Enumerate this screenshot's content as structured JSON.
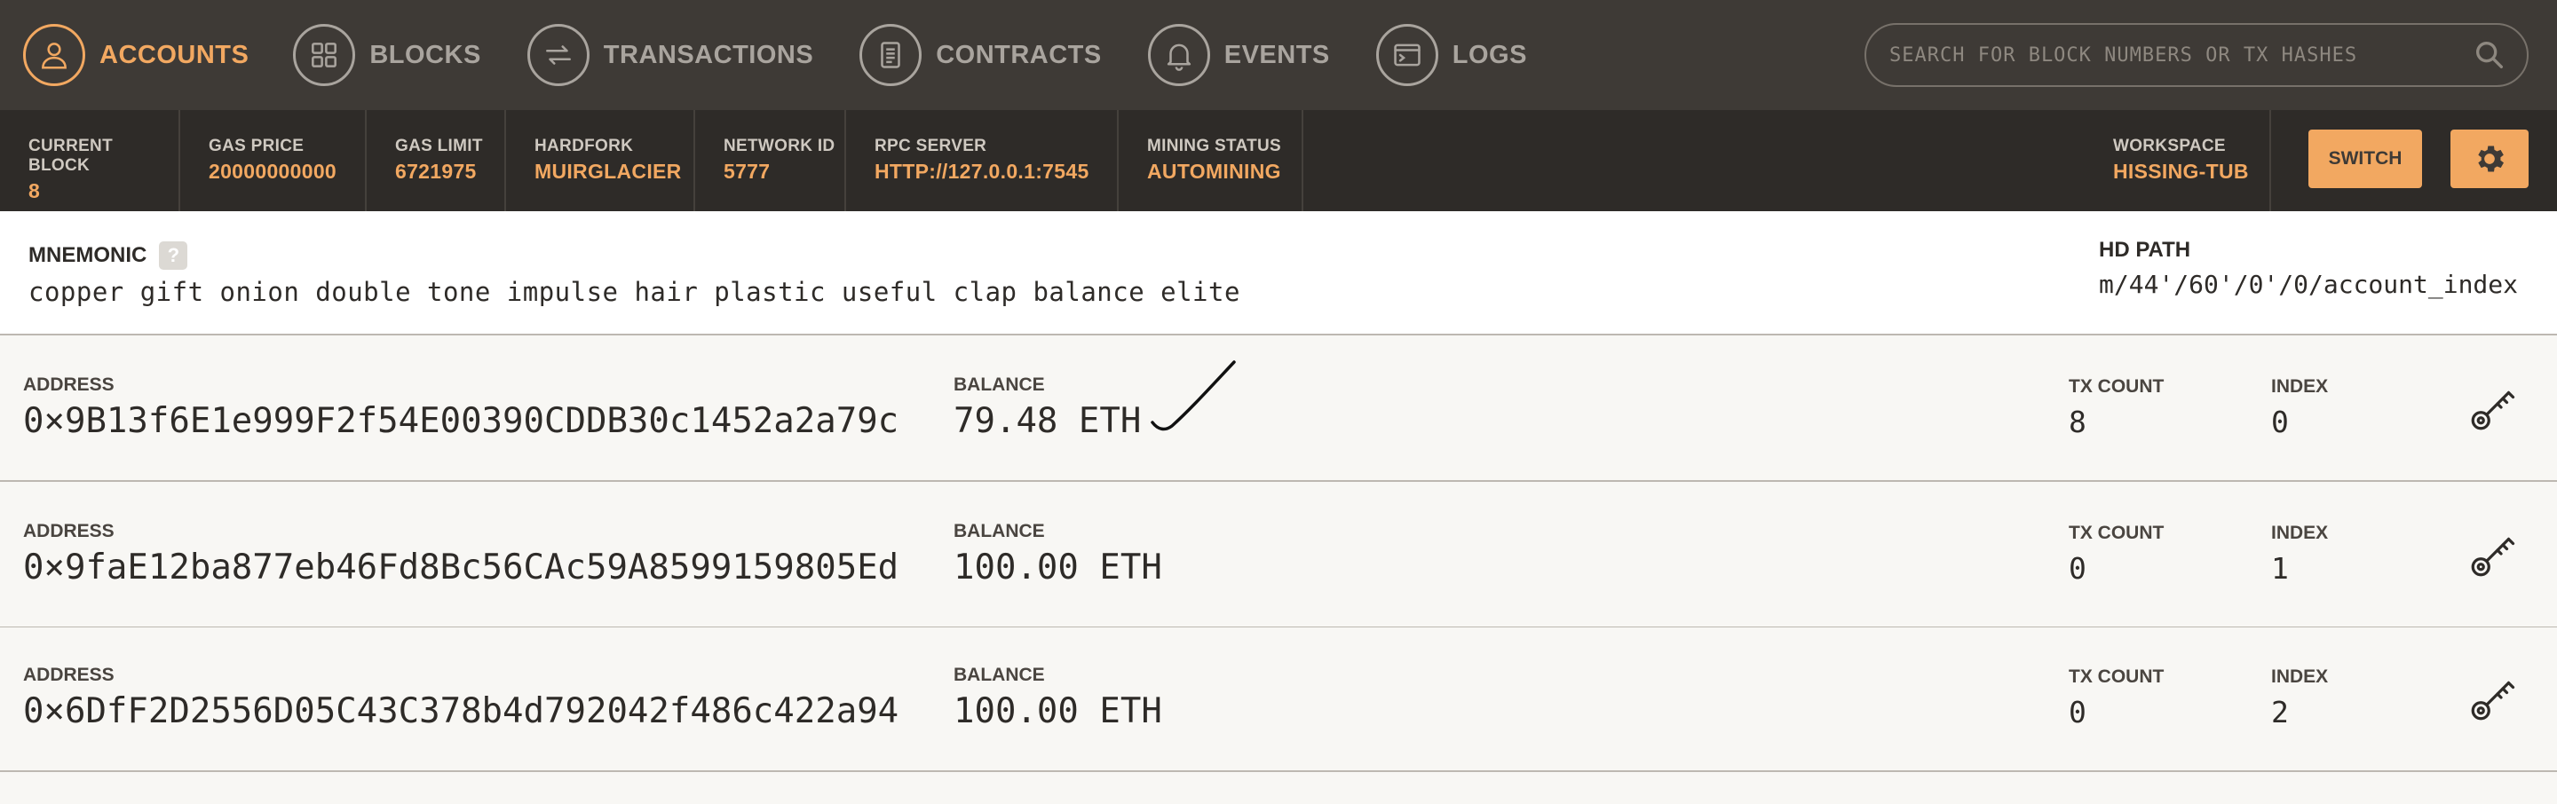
{
  "nav": {
    "items": [
      {
        "label": "ACCOUNTS",
        "icon": "user-icon",
        "active": true
      },
      {
        "label": "BLOCKS",
        "icon": "grid-icon",
        "active": false
      },
      {
        "label": "TRANSACTIONS",
        "icon": "swap-arrows-icon",
        "active": false
      },
      {
        "label": "CONTRACTS",
        "icon": "document-icon",
        "active": false
      },
      {
        "label": "EVENTS",
        "icon": "bell-icon",
        "active": false
      },
      {
        "label": "LOGS",
        "icon": "terminal-icon",
        "active": false
      }
    ],
    "search_placeholder": "SEARCH FOR BLOCK NUMBERS OR TX HASHES"
  },
  "status": {
    "current_block_label": "CURRENT BLOCK",
    "current_block": "8",
    "gas_price_label": "GAS PRICE",
    "gas_price": "20000000000",
    "gas_limit_label": "GAS LIMIT",
    "gas_limit": "6721975",
    "hardfork_label": "HARDFORK",
    "hardfork": "MUIRGLACIER",
    "network_id_label": "NETWORK ID",
    "network_id": "5777",
    "rpc_server_label": "RPC SERVER",
    "rpc_server": "HTTP://127.0.0.1:7545",
    "mining_status_label": "MINING STATUS",
    "mining_status": "AUTOMINING",
    "workspace_label": "WORKSPACE",
    "workspace": "HISSING-TUB",
    "switch_label": "SWITCH"
  },
  "mnemonic": {
    "title": "MNEMONIC",
    "help": "?",
    "words": "copper gift onion double tone impulse hair plastic useful clap balance elite",
    "hd_path_label": "HD PATH",
    "hd_path": "m/44'/60'/0'/0/account_index"
  },
  "labels": {
    "address": "ADDRESS",
    "balance": "BALANCE",
    "tx_count": "TX COUNT",
    "index": "INDEX"
  },
  "accounts": [
    {
      "address": "0×9B13f6E1e999F2f54E00390CDDB30c1452a2a79c",
      "balance": "79.48 ETH",
      "tx_count": "8",
      "index": "0"
    },
    {
      "address": "0×9faE12ba877eb46Fd8Bc56CAc59A8599159805Ed",
      "balance": "100.00 ETH",
      "tx_count": "0",
      "index": "1"
    },
    {
      "address": "0×6DfF2D2556D05C43C378b4d792042f486c422a94",
      "balance": "100.00 ETH",
      "tx_count": "0",
      "index": "2"
    }
  ],
  "colors": {
    "nav_bg": "#3e3a36",
    "status_bg": "#2e2b28",
    "accent": "#f2a861",
    "row_bg": "#f8f7f4"
  }
}
